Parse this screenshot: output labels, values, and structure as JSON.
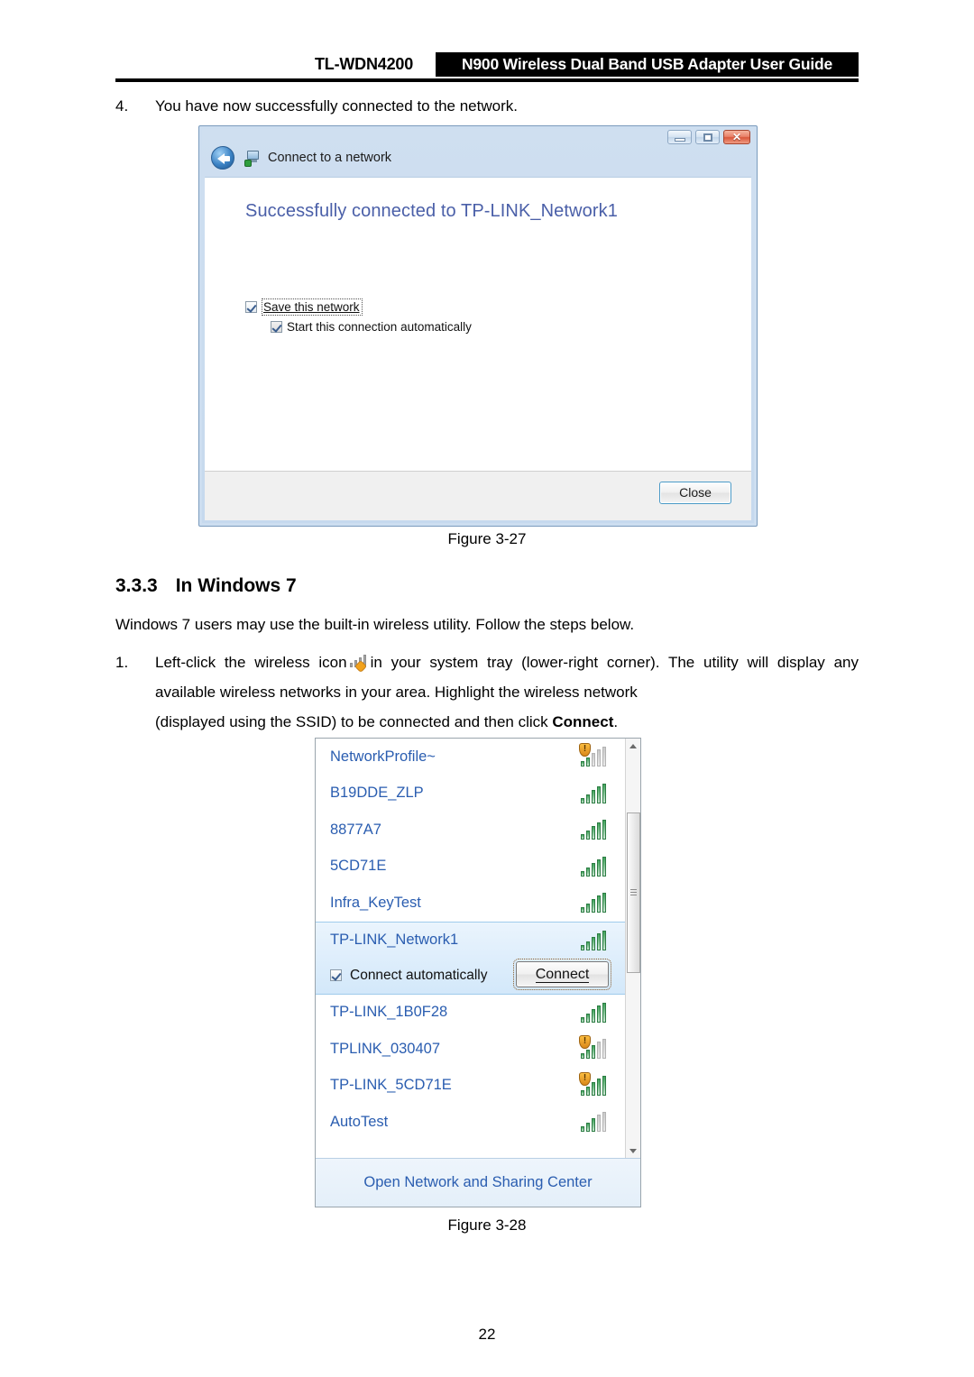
{
  "header": {
    "model": "TL-WDN4200",
    "title": "N900 Wireless Dual Band USB Adapter User Guide"
  },
  "step4": {
    "number": "4.",
    "text": "You have now successfully connected to the network."
  },
  "connect_dialog": {
    "nav_label": "Connect to a network",
    "heading": "Successfully connected to TP-LINK_Network1",
    "checkbox_save": "Save this network",
    "checkbox_start": "Start this connection automatically",
    "close_label": "Close",
    "minimize_glyph": "",
    "maximize_glyph": "",
    "close_glyph": "✕"
  },
  "figure_1_caption": "Figure 3-27",
  "section": {
    "number": "3.3.3",
    "title": "In Windows 7"
  },
  "intro": "Windows 7 users may use the built-in wireless utility. Follow the steps below.",
  "step1": {
    "number": "1.",
    "part1": "Left-click the wireless icon",
    "part2": "in your system tray (lower-right corner). The utility will display any available wireless networks in your area. Highlight the wireless network",
    "part3": "(displayed using the SSID) to be connected and then click ",
    "bold": "Connect",
    "part4": "."
  },
  "win7_flyout": {
    "networks": [
      {
        "ssid": "NetworkProfile~",
        "bars": 2,
        "secure_warning": true
      },
      {
        "ssid": "B19DDE_ZLP",
        "bars": 5,
        "secure_warning": false
      },
      {
        "ssid": "8877A7",
        "bars": 5,
        "secure_warning": false
      },
      {
        "ssid": "5CD71E",
        "bars": 5,
        "secure_warning": false
      },
      {
        "ssid": "Infra_KeyTest",
        "bars": 5,
        "secure_warning": false
      }
    ],
    "selected": {
      "ssid": "TP-LINK_Network1",
      "bars": 5,
      "secure_warning": false,
      "connect_automatically_label": "Connect automatically",
      "connect_button_label": "Connect"
    },
    "networks_after": [
      {
        "ssid": "TP-LINK_1B0F28",
        "bars": 5,
        "secure_warning": false
      },
      {
        "ssid": "TPLINK_030407",
        "bars": 3,
        "secure_warning": true
      },
      {
        "ssid": "TP-LINK_5CD71E",
        "bars": 5,
        "secure_warning": true
      },
      {
        "ssid": "AutoTest",
        "bars": 3,
        "secure_warning": false
      }
    ],
    "footer_link": "Open Network and Sharing Center"
  },
  "figure_2_caption": "Figure 3-28",
  "page_number": "22",
  "colors": {
    "link_blue": "#2a5db0",
    "dialog_heading": "#4a5fa8",
    "signal_green": "#3fa45a",
    "shield_orange": "#f2a21c"
  }
}
